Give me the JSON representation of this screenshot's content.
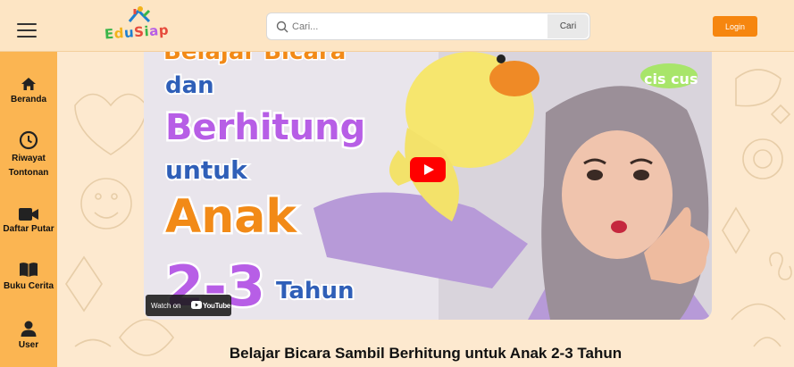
{
  "header": {
    "logo_text": "EduSiap",
    "search": {
      "placeholder": "Cari...",
      "button_label": "Cari"
    },
    "login_label": "Login"
  },
  "sidebar": {
    "items": [
      {
        "label": "Beranda",
        "icon": "home-icon"
      },
      {
        "label": "Riwayat\nTontonan",
        "icon": "clock-icon"
      },
      {
        "label": "Daftar Putar",
        "icon": "video-camera-icon"
      },
      {
        "label": "Buku Cerita",
        "icon": "book-icon"
      },
      {
        "label": "User",
        "icon": "user-icon"
      }
    ]
  },
  "video": {
    "thumbnail_text": {
      "line1": "Belajar Bicara",
      "line2": "dan",
      "line3": "Berhitung",
      "line4": "untuk",
      "line5": "Anak",
      "line6": "2-3",
      "line7": "Tahun",
      "channel_badge": "cis cus"
    },
    "watch_on": "Watch on",
    "youtube": "YouTube",
    "title": "Belajar Bicara Sambil Berhitung untuk Anak 2-3 Tahun"
  },
  "colors": {
    "sidebar": "#fbb552",
    "header": "#fde5c4",
    "background": "#fde9cf",
    "accent": "#f6860f",
    "thumb_blue": "#2f5fb8",
    "thumb_purple": "#b75ee6",
    "thumb_orange": "#f28a17"
  }
}
